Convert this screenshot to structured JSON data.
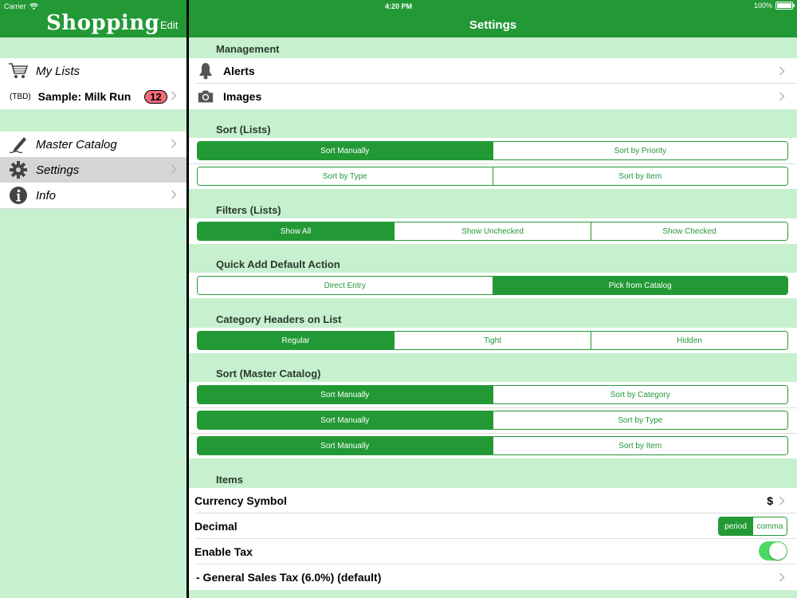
{
  "status_bar": {
    "carrier": "Carrier",
    "time": "4:20 PM",
    "battery": "100%",
    "battery_level": 1.0
  },
  "app_title": "Shopping",
  "edit_label": "Edit",
  "nav_title": "Settings",
  "sidebar": {
    "my_lists": "My Lists",
    "list_prefix": "(TBD)",
    "list_name": "Sample: Milk Run",
    "list_count": "12",
    "items": [
      {
        "label": "Master Catalog",
        "icon": "pen-icon"
      },
      {
        "label": "Settings",
        "icon": "gear-icon"
      },
      {
        "label": "Info",
        "icon": "info-icon"
      }
    ]
  },
  "management": {
    "header": "Management",
    "alerts": "Alerts",
    "images": "Images"
  },
  "sort_lists": {
    "header": "Sort (Lists)",
    "rows": [
      {
        "options": [
          "Sort Manually",
          "Sort by Priority"
        ],
        "selected": 0
      },
      {
        "options": [
          "Sort by Type",
          "Sort by Item"
        ],
        "selected": -1
      }
    ]
  },
  "filters": {
    "header": "Filters (Lists)",
    "options": [
      "Show All",
      "Show Unchecked",
      "Show Checked"
    ],
    "selected": 0
  },
  "quick_add": {
    "header": "Quick Add Default Action",
    "options": [
      "Direct Entry",
      "Pick from Catalog"
    ],
    "selected": 1
  },
  "category_headers": {
    "header": "Category Headers on List",
    "options": [
      "Regular",
      "Tight",
      "Hidden"
    ],
    "selected": 0
  },
  "sort_catalog": {
    "header": "Sort (Master Catalog)",
    "rows": [
      {
        "options": [
          "Sort Manually",
          "Sort by Category"
        ],
        "selected": 0
      },
      {
        "options": [
          "Sort Manually",
          "Sort by Type"
        ],
        "selected": 0
      },
      {
        "options": [
          "Sort Manually",
          "Sort by Item"
        ],
        "selected": 0
      }
    ]
  },
  "items": {
    "header": "Items",
    "currency_label": "Currency Symbol",
    "currency_value": "$",
    "decimal_label": "Decimal",
    "decimal_options": [
      "period",
      "comma"
    ],
    "decimal_selected": 0,
    "tax_label": "Enable Tax",
    "tax_enabled": true,
    "sales_tax": "- General Sales Tax (6.0%) (default)"
  },
  "colors": {
    "accent": "#239936",
    "background": "#c7f0cf",
    "badge": "#f26b7a"
  }
}
